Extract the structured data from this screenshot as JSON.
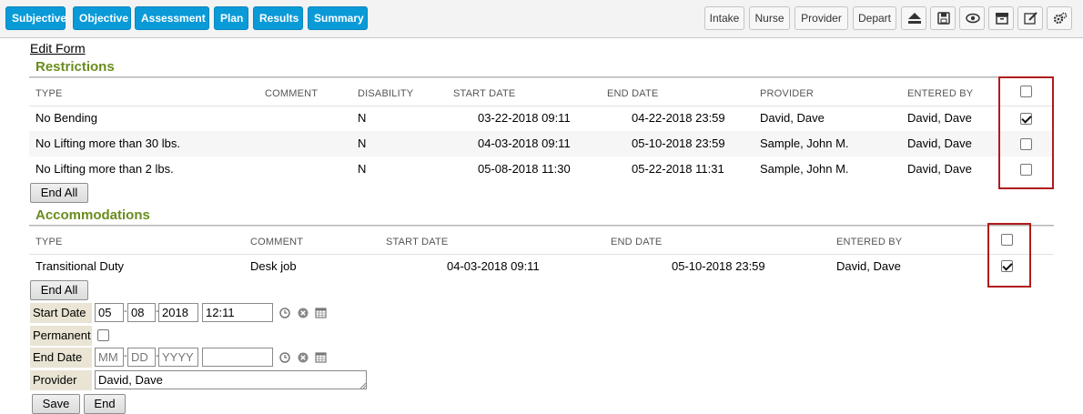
{
  "tabs": [
    "Subjective",
    "Objective",
    "Assessment",
    "Plan",
    "Results",
    "Summary"
  ],
  "tools": [
    "Intake",
    "Nurse",
    "Provider",
    "Depart"
  ],
  "tool_icons": [
    "eject-icon",
    "save-icon",
    "eye-icon",
    "archive-icon",
    "edit-icon",
    "settings-icon"
  ],
  "edit_form_link": "Edit Form",
  "restrictions": {
    "title": "Restrictions",
    "headers": [
      "TYPE",
      "COMMENT",
      "DISABILITY",
      "START DATE",
      "END DATE",
      "PROVIDER",
      "ENTERED BY"
    ],
    "rows": [
      {
        "type": "No Bending",
        "comment": "",
        "disability": "N",
        "start": "03-22-2018 09:11",
        "end": "04-22-2018 23:59",
        "provider": "David, Dave",
        "entered_by": "David, Dave",
        "checked": true
      },
      {
        "type": "No Lifting more than 30 lbs.",
        "comment": "",
        "disability": "N",
        "start": "04-03-2018 09:11",
        "end": "05-10-2018 23:59",
        "provider": "Sample, John M.",
        "entered_by": "David, Dave",
        "checked": false
      },
      {
        "type": "No Lifting more than 2 lbs.",
        "comment": "",
        "disability": "N",
        "start": "05-08-2018 11:30",
        "end": "05-22-2018 11:31",
        "provider": "Sample, John M.",
        "entered_by": "David, Dave",
        "checked": false
      }
    ],
    "end_all": "End All"
  },
  "accommodations": {
    "title": "Accommodations",
    "headers": [
      "TYPE",
      "COMMENT",
      "START DATE",
      "END DATE",
      "ENTERED BY"
    ],
    "rows": [
      {
        "type": "Transitional Duty",
        "comment": "Desk job",
        "start": "04-03-2018 09:11",
        "end": "05-10-2018 23:59",
        "entered_by": "David, Dave",
        "checked": true
      }
    ],
    "end_all": "End All"
  },
  "form": {
    "start_date_label": "Start Date",
    "start_mm": "05",
    "start_dd": "08",
    "start_yyyy": "2018",
    "start_time": "12:11",
    "permanent_label": "Permanent",
    "end_date_label": "End Date",
    "end_mm_placeholder": "MM",
    "end_dd_placeholder": "DD",
    "end_yyyy_placeholder": "YYYY",
    "end_time": "",
    "provider_label": "Provider",
    "provider_value": "David, Dave",
    "save_label": "Save",
    "end_label": "End"
  },
  "colors": {
    "tab_blue": "#0a9ad8",
    "section_green": "#6a8c1e",
    "highlight_red": "#b01c1c"
  }
}
